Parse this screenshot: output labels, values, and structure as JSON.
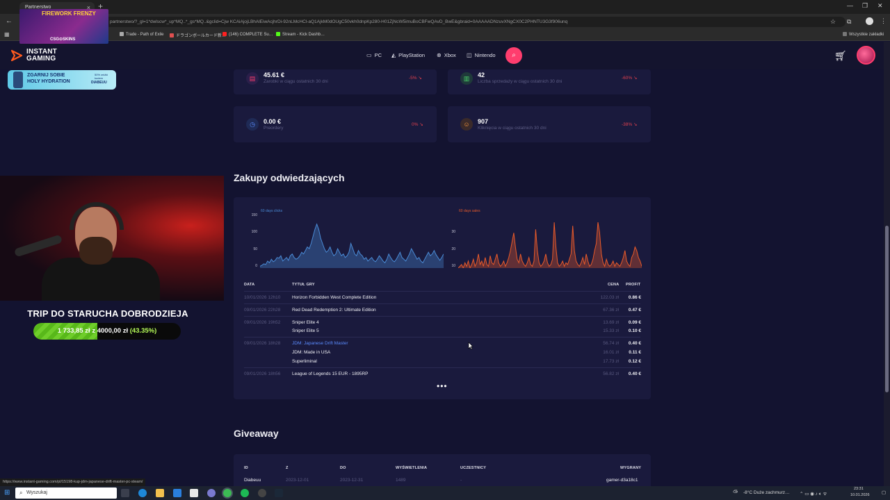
{
  "browser": {
    "tab_title": "Partnerstwo",
    "url": "partnerstwo/?_gl=1*dwlscw*_up*MQ..*_gs*MQ..&gclid=Cjw KCAiAjojLBhAlEiwAcjhrDi-92nLMcHCl-aQ1AjkM0dOUgC50vkh0dnpKp280-H01ZjNcW5imuBoCBFwQAvD_BwE&gbraid=0AAAAADNzuvXNgCX0C2PHNTU3G3f906unq",
    "bookmarks": [
      "Trade - Path of Exile",
      "ドラゴンボールカード新…",
      "(146) COMPLETE Su…",
      "Stream - Kick Dashb…"
    ],
    "bookmarks_right": "Wszystkie zakładki",
    "status_url": "https://www.instant-gaming.com/pl/15198-kup-jdm-japanese-drift-master-pc-steam/"
  },
  "site": {
    "logo_line1": "INSTANT",
    "logo_line2": "GAMING",
    "nav": [
      {
        "label": "PC",
        "icon": "monitor-icon"
      },
      {
        "label": "PlayStation",
        "icon": "playstation-icon"
      },
      {
        "label": "Xbox",
        "icon": "xbox-icon"
      },
      {
        "label": "Nintendo",
        "icon": "nintendo-icon"
      }
    ]
  },
  "stats": [
    {
      "value": "45.61 €",
      "label": "Zarobki w ciągu ostatnich 30 dni",
      "pct": "-5%",
      "icon": "money-icon",
      "color": "#ff3d6e"
    },
    {
      "value": "42",
      "label": "Liczba sprzedaży w ciągu ostatnich 30 dni",
      "pct": "-60%",
      "icon": "chart-icon",
      "color": "#4cd36a"
    },
    {
      "value": "0.00 €",
      "label": "Preordery",
      "pct": "0%",
      "icon": "clock-icon",
      "color": "#5b8cff"
    },
    {
      "value": "907",
      "label": "Kliknięcia w ciągu ostatnich 30 dni",
      "pct": "-38%",
      "icon": "user-icon",
      "color": "#ff9a3d"
    }
  ],
  "purchases": {
    "title": "Zakupy odwiedzających",
    "headers": {
      "date": "DATA",
      "game": "TYTUŁ GRY",
      "price": "CENA",
      "profit": "PROFIT"
    },
    "rows": [
      {
        "date": "10/01/2026 12h10",
        "items": [
          {
            "title": "Horizon Forbidden West Complete Edition",
            "price": "122.03 zł",
            "profit": "0.86 €"
          }
        ]
      },
      {
        "date": "09/01/2026 22h28",
        "items": [
          {
            "title": "Red Dead Redemption 2: Ultimate Edition",
            "price": "67.36 zł",
            "profit": "0.47 €"
          }
        ]
      },
      {
        "date": "09/01/2026 19h52",
        "items": [
          {
            "title": "Sniper Elite 4",
            "price": "13.69 zł",
            "profit": "0.09 €"
          },
          {
            "title": "Sniper Elite 5",
            "price": "15.33 zł",
            "profit": "0.10 €"
          }
        ]
      },
      {
        "date": "09/01/2026 18h28",
        "items": [
          {
            "title": "JDM: Japanese Drift Master",
            "price": "56.74 zł",
            "profit": "0.40 €",
            "link": true
          },
          {
            "title": "JDM: Made in USA",
            "price": "16.01 zł",
            "profit": "0.11 €"
          },
          {
            "title": "Superliminal",
            "price": "17.73 zł",
            "profit": "0.12 €"
          }
        ]
      },
      {
        "date": "09/01/2026 18h56",
        "items": [
          {
            "title": "League of Legends 15 EUR - 1895RP",
            "price": "56.82 zł",
            "profit": "0.40 €"
          }
        ]
      }
    ],
    "more": "•••"
  },
  "chart_data": [
    {
      "type": "area",
      "legend": "60 days clicks",
      "ylim": [
        0,
        150
      ],
      "yticks": [
        "150",
        "100",
        "50",
        "0"
      ],
      "values": [
        5,
        8,
        12,
        10,
        20,
        15,
        25,
        18,
        22,
        30,
        28,
        35,
        20,
        25,
        30,
        22,
        35,
        40,
        30,
        25,
        28,
        35,
        45,
        40,
        50,
        60,
        55,
        70,
        90,
        110,
        125,
        110,
        85,
        70,
        55,
        45,
        50,
        60,
        45,
        35,
        40,
        55,
        45,
        35,
        40,
        30,
        35,
        45,
        70,
        55,
        40,
        35,
        50,
        40,
        35,
        25,
        30,
        20,
        25,
        30,
        22,
        18,
        25,
        35,
        28,
        20,
        15,
        25,
        40,
        30,
        22,
        18,
        25,
        35,
        45,
        30,
        25,
        20,
        30,
        40,
        55,
        45,
        35,
        25,
        30,
        20,
        15,
        25,
        35,
        45,
        35,
        40,
        50,
        38,
        30,
        22,
        30,
        40
      ],
      "color": "#4a8bd6"
    },
    {
      "type": "area",
      "legend": "60 days sales",
      "ylim": [
        0,
        30
      ],
      "yticks": [
        "30",
        "20",
        "10",
        "0"
      ],
      "values": [
        0,
        1,
        2,
        0,
        3,
        1,
        4,
        0,
        2,
        5,
        1,
        3,
        8,
        2,
        4,
        1,
        6,
        2,
        1,
        7,
        3,
        2,
        5,
        8,
        3,
        1,
        2,
        4,
        1,
        3,
        6,
        10,
        15,
        20,
        12,
        5,
        3,
        8,
        4,
        2,
        1,
        3,
        6,
        2,
        1,
        4,
        22,
        10,
        3,
        1,
        2,
        4,
        8,
        3,
        1,
        2,
        5,
        26,
        12,
        3,
        1,
        2,
        4,
        1,
        3,
        2,
        5,
        8,
        24,
        10,
        4,
        2,
        1,
        3,
        6,
        2,
        8,
        4,
        1,
        2,
        5,
        10,
        14,
        26,
        20,
        8,
        3,
        1,
        5,
        2,
        1,
        2,
        4,
        1,
        3,
        2,
        1,
        3,
        6,
        10,
        4,
        2,
        1,
        6,
        8,
        12,
        10,
        6,
        4,
        1
      ],
      "color": "#e85a2a"
    }
  ],
  "giveaway": {
    "title": "Giveaway",
    "headers": {
      "id": "ID",
      "from": "Z",
      "to": "DO",
      "views": "WYŚWIETLENIA",
      "participants": "UCZESTNICY",
      "winners": "WYGRANY"
    },
    "row": {
      "id": "Diabeuu",
      "from": "2023-12-01",
      "to": "2023-12-31",
      "views": "1489",
      "participants": "-",
      "winner": "gamer-d3a18c1"
    }
  },
  "overlay": {
    "promo_line1": "ZGARNIJ SOBIE",
    "promo_line2": "HOLY HYDRATION",
    "promo_tag": "DIABEUU",
    "promo_small": "50% zniżki kodem",
    "fw_title": "FIREWORK FRENZY",
    "fw_brand": "CSG⊙SKINS",
    "goal_title": "TRIP DO STARUCHA DOBRODZIEJA",
    "goal_amount": "1 733,85 zł",
    "goal_sep": "z",
    "goal_target": "4000,00 zł",
    "goal_pct": "(43.35%)",
    "goal_fraction": 0.4335
  },
  "taskbar": {
    "search": "Wyszukaj",
    "weather": "-8°C  Duże zachmurz…",
    "time": "23:31",
    "date": "10.01.2026"
  }
}
